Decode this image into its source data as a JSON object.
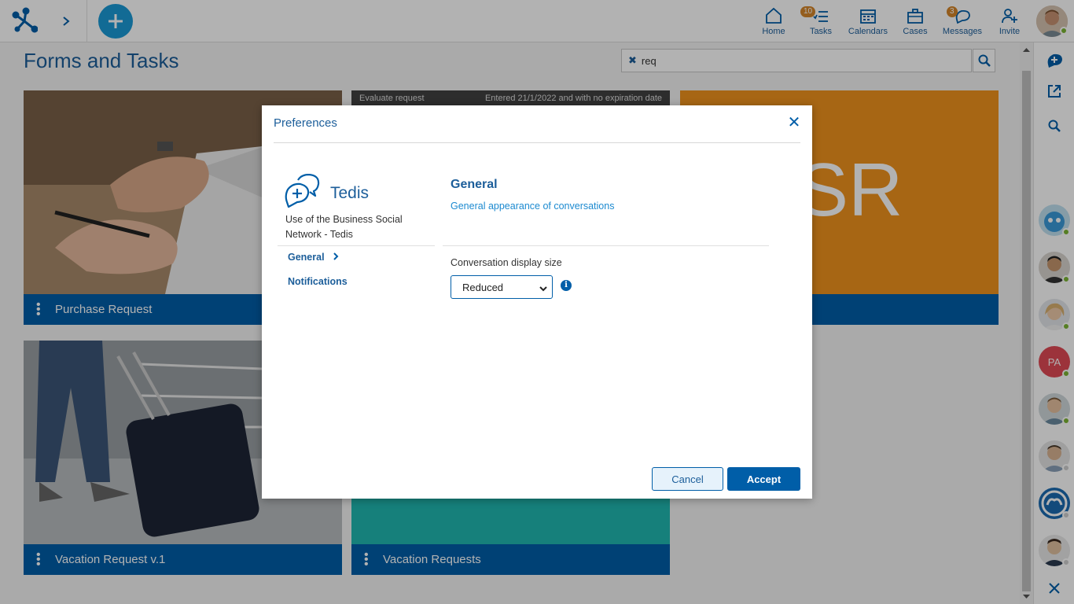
{
  "header": {
    "nav": [
      {
        "label": "Home",
        "icon": "home-icon"
      },
      {
        "label": "Tasks",
        "icon": "tasks-icon",
        "badge": "10"
      },
      {
        "label": "Calendars",
        "icon": "calendar-icon"
      },
      {
        "label": "Cases",
        "icon": "briefcase-icon"
      },
      {
        "label": "Messages",
        "icon": "messages-icon",
        "badge": "3"
      },
      {
        "label": "Invite",
        "icon": "invite-user-icon"
      }
    ]
  },
  "main": {
    "title": "Forms and Tasks",
    "search_value": "req",
    "cards": [
      {
        "label": "Purchase Request"
      },
      {
        "label": "Evaluate request",
        "meta": "Entered 21/1/2022 and with no expiration date"
      },
      {
        "label": "SR"
      },
      {
        "label": "Vacation Request v.1"
      },
      {
        "label": "Vacation Requests"
      }
    ]
  },
  "sidebar": {
    "avatar_initials": "PA"
  },
  "modal": {
    "title": "Preferences",
    "app_name": "Tedis",
    "app_description": "Use of the Business Social Network - Tedis",
    "menu": {
      "general": "General",
      "notifications": "Notifications"
    },
    "section_title": "General",
    "section_subtitle": "General appearance of conversations",
    "field_label": "Conversation display size",
    "field_value": "Reduced",
    "cancel_label": "Cancel",
    "accept_label": "Accept"
  },
  "colors": {
    "brand": "#005ea8",
    "accent_orange": "#f0921e",
    "teal": "#20b8b0",
    "badge": "#d4862a"
  }
}
